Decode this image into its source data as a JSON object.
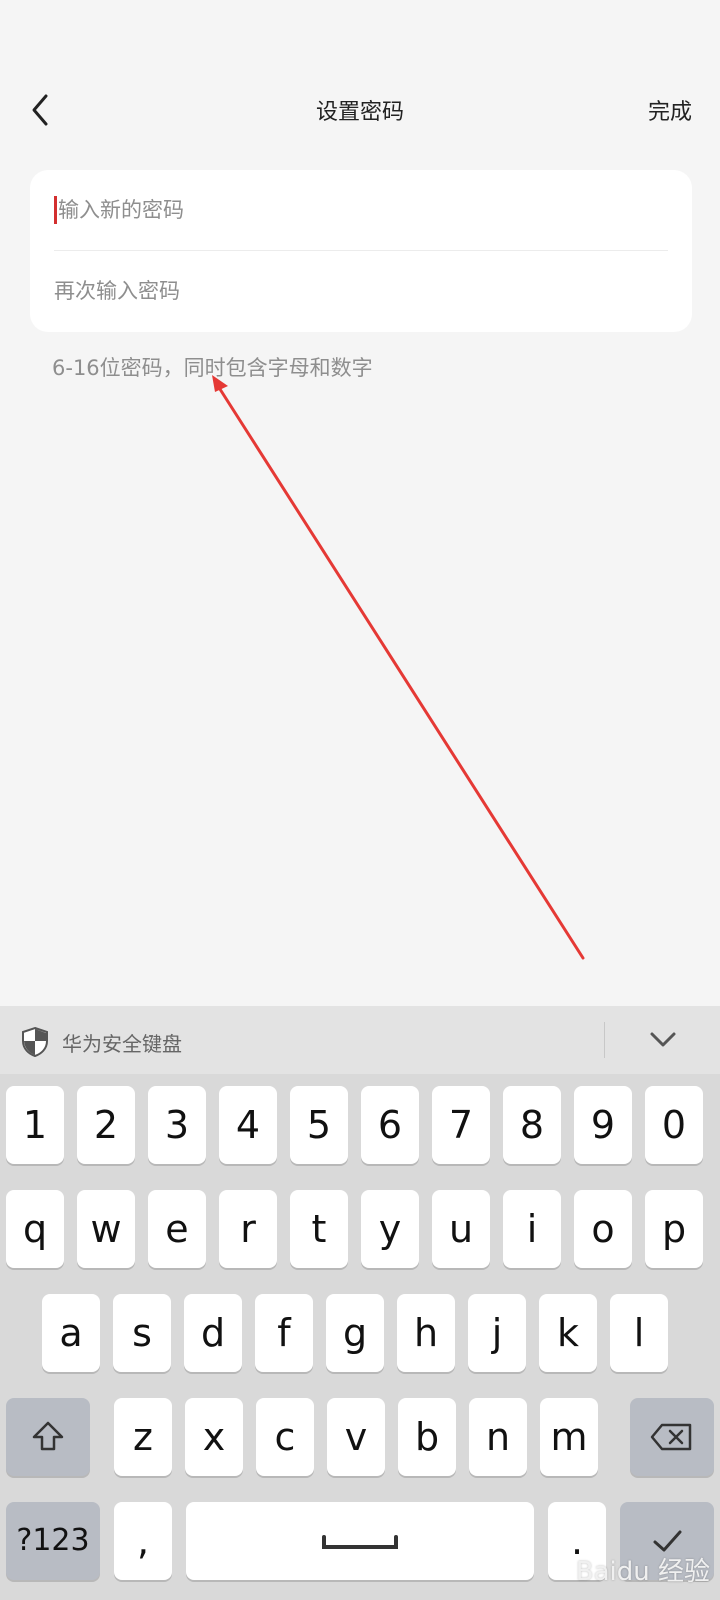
{
  "header": {
    "title": "设置密码",
    "done_label": "完成"
  },
  "form": {
    "new_password_placeholder": "输入新的密码",
    "confirm_password_placeholder": "再次输入密码",
    "hint": "6-16位密码，同时包含字母和数字"
  },
  "keyboard": {
    "name": "华为安全键盘",
    "row_numbers": [
      "1",
      "2",
      "3",
      "4",
      "5",
      "6",
      "7",
      "8",
      "9",
      "0"
    ],
    "row_top": [
      "q",
      "w",
      "e",
      "r",
      "t",
      "y",
      "u",
      "i",
      "o",
      "p"
    ],
    "row_middle": [
      "a",
      "s",
      "d",
      "f",
      "g",
      "h",
      "j",
      "k",
      "l"
    ],
    "row_bottom": [
      "z",
      "x",
      "c",
      "v",
      "b",
      "n",
      "m"
    ],
    "symbols_label": "?123",
    "comma_label": ",",
    "period_label": "."
  },
  "watermark": "Baidu 经验",
  "colors": {
    "background": "#f5f5f5",
    "card": "#ffffff",
    "cursor": "#d32f2f",
    "annotation_arrow": "#e53935",
    "keyboard_bg": "#d9d9d9",
    "function_key": "#b8bcc4"
  }
}
